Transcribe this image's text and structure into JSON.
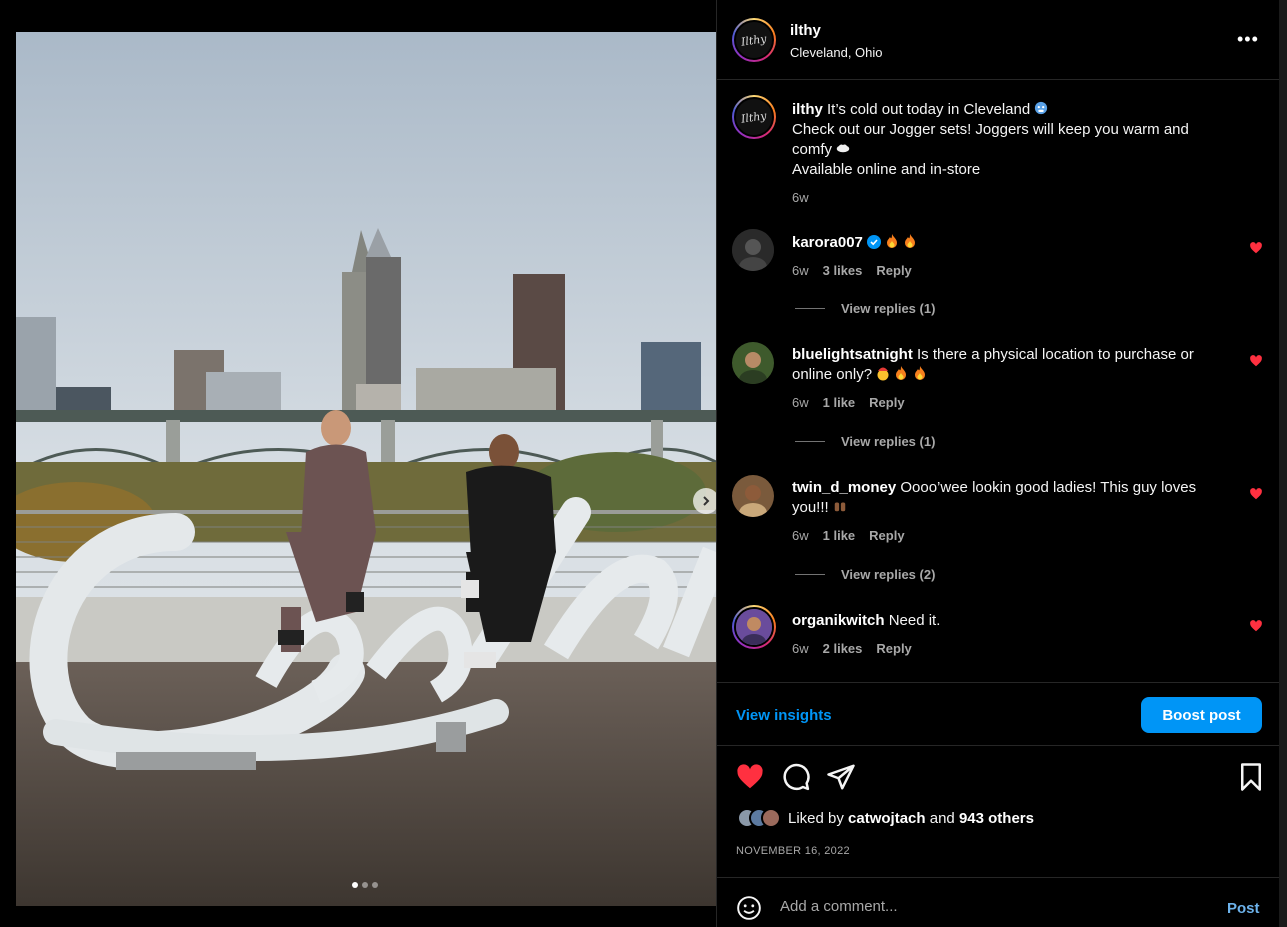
{
  "post": {
    "username": "ilthy",
    "location": "Cleveland, Ohio",
    "avatar_text": "Ilthy",
    "more_icon": "more-horizontal-icon",
    "caption": {
      "line1": "It’s cold out today in Cleveland",
      "line2": "Check out our Jogger sets! Joggers will keep you warm and comfy",
      "line3": "Available online and in-store",
      "time": "6w"
    },
    "photo": {
      "sign_text": "Cleveland",
      "carousel_dots": 3,
      "active_dot": 0
    }
  },
  "comments": [
    {
      "username": "karora007",
      "verified": true,
      "text": "",
      "emojis": [
        "fire",
        "fire"
      ],
      "time": "6w",
      "likes": "3 likes",
      "reply": "Reply",
      "replies": "View replies (1)"
    },
    {
      "username": "bluelightsatnight",
      "verified": false,
      "text": "Is there a physical location to purchase or online only?",
      "emojis": [
        "exploding-head",
        "fire",
        "fire"
      ],
      "time": "6w",
      "likes": "1 like",
      "reply": "Reply",
      "replies": "View replies (1)"
    },
    {
      "username": "twin_d_money",
      "verified": false,
      "text": "Oooo’wee lookin good ladies! This guy loves you!!!",
      "emojis": [
        "raised-hands"
      ],
      "time": "6w",
      "likes": "1 like",
      "reply": "Reply",
      "replies": "View replies (2)"
    },
    {
      "username": "organikwitch",
      "verified": false,
      "text": "Need it.",
      "emojis": [],
      "time": "6w",
      "likes": "2 likes",
      "reply": "Reply",
      "replies": ""
    }
  ],
  "insights": {
    "view_label": "View insights",
    "boost_label": "Boost post"
  },
  "engagement": {
    "liked_prefix": "Liked by",
    "liked_user": "catwojtach",
    "liked_and": "and",
    "liked_others": "943 others",
    "date": "NOVEMBER 16, 2022"
  },
  "comment_box": {
    "placeholder": "Add a comment...",
    "post_label": "Post"
  },
  "colors": {
    "accent": "#0095f6",
    "like_red": "#ff3040",
    "background": "#000000",
    "secondary_text": "#a8a8a8"
  }
}
